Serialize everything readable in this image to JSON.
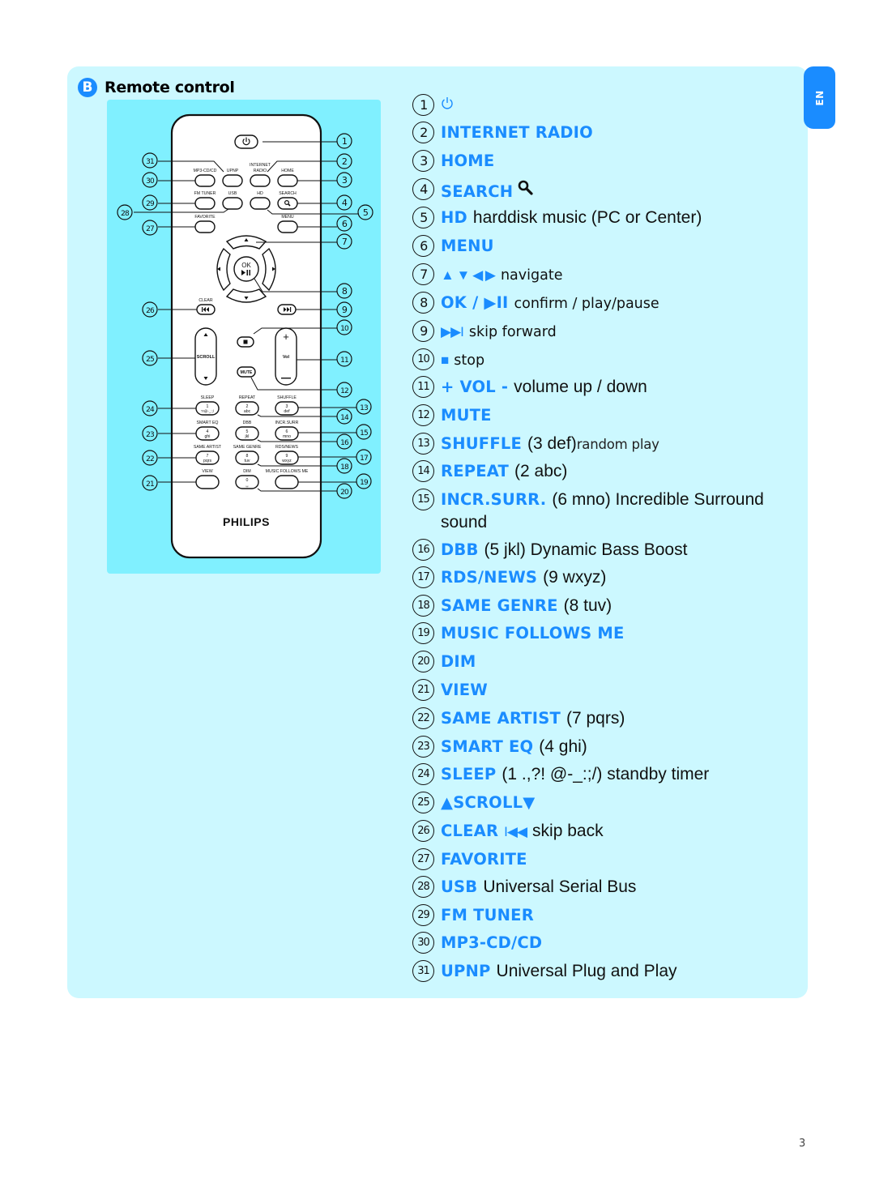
{
  "section": {
    "badge": "B",
    "title": "Remote control"
  },
  "lang_tab": "EN",
  "page_number": "3",
  "colors": {
    "accent": "#1a8cff",
    "panel_bg": "#ccf8ff",
    "remote_bg": "#80f0ff"
  },
  "remote": {
    "brand": "PHILIPS",
    "labels": {
      "mp3cd": "MP3-CD/CD",
      "upnp": "UPNP",
      "internet1": "INTERNET",
      "internet2": "RADIO",
      "home": "HOME",
      "fmtuner": "FM TUNER",
      "usb": "USB",
      "hd": "HD",
      "search": "SEARCH",
      "favorite": "FAVORITE",
      "menu": "MENU",
      "clear": "CLEAR",
      "ok": "OK",
      "scroll": "SCROLL",
      "vol": "Vol",
      "mute": "MUTE",
      "sleep": "SLEEP",
      "repeat": "REPEAT",
      "shuffle": "SHUFFLE",
      "smarteq": "SMART EQ",
      "dbb": "DBB",
      "incrsurr": "INCR.SURR",
      "sameartist": "SAME ARTIST",
      "samegenre": "SAME GENRE",
      "rdsnews": "RDS/NEWS",
      "view": "VIEW",
      "dim": "DIM",
      "musicfollows": "MUSIC FOLLOWS ME"
    },
    "keys": {
      "k1a": "1",
      "k1b": "?!@-_:;/",
      "k2a": "2",
      "k2b": "abc",
      "k3a": "3",
      "k3b": "def",
      "k4a": "4",
      "k4b": "ghi",
      "k5a": "5",
      "k5b": "jkl",
      "k6a": "6",
      "k6b": "mno",
      "k7a": "7",
      "k7b": "pqrs",
      "k8a": "8",
      "k8b": "tuv",
      "k9a": "9",
      "k9b": "wxyz",
      "k0a": "0",
      "k0b": "␣"
    },
    "callouts": [
      "1",
      "2",
      "3",
      "4",
      "5",
      "6",
      "7",
      "8",
      "9",
      "10",
      "11",
      "12",
      "13",
      "14",
      "15",
      "16",
      "17",
      "18",
      "19",
      "20",
      "21",
      "22",
      "23",
      "24",
      "25",
      "26",
      "27",
      "28",
      "29",
      "30",
      "31"
    ]
  },
  "legend": [
    {
      "n": "1",
      "icon": "power-icon",
      "kw": "",
      "desc": ""
    },
    {
      "n": "2",
      "kw": "INTERNET RADIO",
      "desc": ""
    },
    {
      "n": "3",
      "kw": "HOME",
      "desc": ""
    },
    {
      "n": "4",
      "kw": "SEARCH",
      "icon": "search-icon",
      "desc": ""
    },
    {
      "n": "5",
      "kw": "HD",
      "desc": "harddisk music (PC or Center)"
    },
    {
      "n": "6",
      "kw": "MENU",
      "desc": ""
    },
    {
      "n": "7",
      "symbols": "▲ ▼ ◀ ▶",
      "desc": "navigate"
    },
    {
      "n": "8",
      "kw": "OK / ▶II",
      "desc": "confirm / play/pause"
    },
    {
      "n": "9",
      "symbols": "▶▶I",
      "desc": "skip forward"
    },
    {
      "n": "10",
      "symbols": "■",
      "desc": "stop"
    },
    {
      "n": "11",
      "kw": "+ VOL -",
      "desc": "volume up / down"
    },
    {
      "n": "12",
      "kw": "MUTE",
      "desc": ""
    },
    {
      "n": "13",
      "kw": "SHUFFLE",
      "desc": "(3 def)",
      "desc2": "random play"
    },
    {
      "n": "14",
      "kw": "REPEAT",
      "desc": "(2 abc)"
    },
    {
      "n": "15",
      "kw": "INCR.SURR.",
      "desc": "(6 mno) Incredible Surround",
      "desc_line2": "sound"
    },
    {
      "n": "16",
      "kw": "DBB",
      "desc": "(5 jkl) Dynamic Bass Boost"
    },
    {
      "n": "17",
      "kw": "RDS/NEWS",
      "desc": "(9 wxyz)"
    },
    {
      "n": "18",
      "kw": "SAME GENRE",
      "desc": "(8 tuv)"
    },
    {
      "n": "19",
      "kw": "MUSIC FOLLOWS ME",
      "desc": ""
    },
    {
      "n": "20",
      "kw": "DIM",
      "desc": ""
    },
    {
      "n": "21",
      "kw": "VIEW",
      "desc": ""
    },
    {
      "n": "22",
      "kw": "SAME ARTIST",
      "desc": "(7 pqrs)"
    },
    {
      "n": "23",
      "kw": "SMART EQ",
      "desc": "(4 ghi)"
    },
    {
      "n": "24",
      "kw": "SLEEP",
      "desc": "(1 .,?! @-_:;/) standby timer"
    },
    {
      "n": "25",
      "kw": "▲SCROLL▼",
      "desc": ""
    },
    {
      "n": "26",
      "kw": "CLEAR",
      "symbols": "I◀◀",
      "desc": "skip back"
    },
    {
      "n": "27",
      "kw": "FAVORITE",
      "desc": ""
    },
    {
      "n": "28",
      "kw": "USB",
      "desc": "Universal Serial Bus"
    },
    {
      "n": "29",
      "kw": "FM TUNER",
      "desc": ""
    },
    {
      "n": "30",
      "kw": "MP3-CD/CD",
      "desc": ""
    },
    {
      "n": "31",
      "kw": "UPNP",
      "desc": "Universal Plug and Play"
    }
  ]
}
